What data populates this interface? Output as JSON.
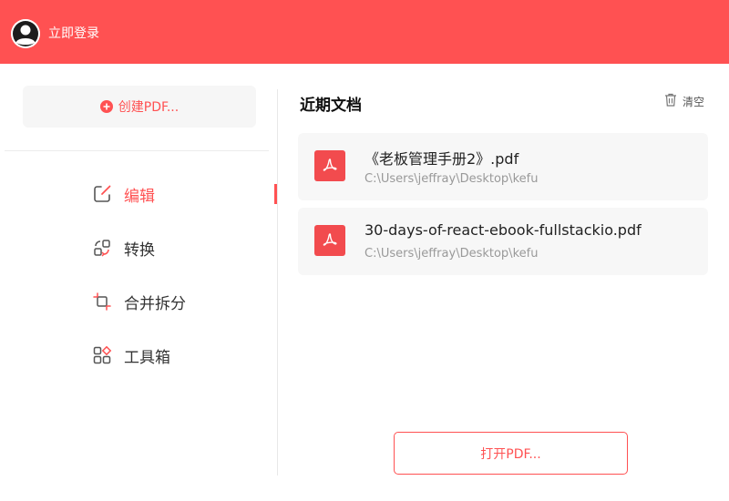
{
  "header": {
    "login_label": "立即登录",
    "bg_color": "#ff5152"
  },
  "sidebar": {
    "create_label": "创建PDF...",
    "items": [
      {
        "label": "编辑",
        "icon": "edit-icon",
        "active": true
      },
      {
        "label": "转换",
        "icon": "convert-icon",
        "active": false
      },
      {
        "label": "合并拆分",
        "icon": "merge-split-icon",
        "active": false
      },
      {
        "label": "工具箱",
        "icon": "toolbox-icon",
        "active": false
      }
    ]
  },
  "recent": {
    "title": "近期文档",
    "clear_label": "清空",
    "files": [
      {
        "name": "《老板管理手册2》.pdf",
        "path": "C:\\Users\\jeffray\\Desktop\\kefu",
        "icon": "pdf-icon"
      },
      {
        "name": "30-days-of-react-ebook-fullstackio.pdf",
        "path": "C:\\Users\\jeffray\\Desktop\\kefu",
        "icon": "pdf-icon"
      }
    ]
  },
  "open_button_label": "打开PDF...",
  "colors": {
    "accent": "#ff5152",
    "pdf_icon_bg": "#f24b4e"
  }
}
